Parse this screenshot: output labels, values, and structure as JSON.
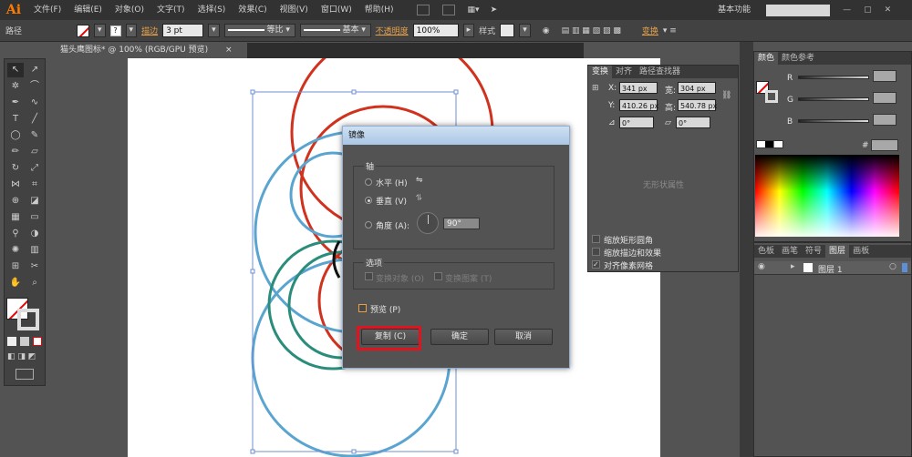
{
  "app_logo": "Ai",
  "menu": [
    "文件(F)",
    "编辑(E)",
    "对象(O)",
    "文字(T)",
    "选择(S)",
    "效果(C)",
    "视图(V)",
    "窗口(W)",
    "帮助(H)"
  ],
  "workspace": "基本功能",
  "control": {
    "path_label": "路径",
    "stroke_label": "描边",
    "stroke_value": "3 pt",
    "profile1": "等比",
    "profile2": "基本",
    "opacity_label": "不透明度",
    "opacity_value": "100%",
    "style_label": "样式",
    "transform_label": "变换"
  },
  "doc_tab": "猫头鹰图标* @ 100% (RGB/GPU 预览)",
  "dialog": {
    "title": "镜像",
    "axis_group": "轴",
    "horizontal": "水平 (H)",
    "vertical": "垂直 (V)",
    "angle_label": "角度 (A):",
    "angle_value": "90°",
    "options_group": "选项",
    "transform_objects": "变换对象 (O)",
    "transform_patterns": "变换图案 (T)",
    "preview": "预览 (P)",
    "copy_button": "复制 (C)",
    "ok_button": "确定",
    "cancel_button": "取消"
  },
  "transform_panel": {
    "tabs": [
      "变换",
      "对齐",
      "路径查找器"
    ],
    "x_label": "X:",
    "x_value": "341 px",
    "w_label": "宽:",
    "w_value": "304 px",
    "y_label": "Y:",
    "y_value": "410.26 px",
    "h_label": "高:",
    "h_value": "540.78 px",
    "angle1": "0°",
    "angle2": "0°",
    "no_shape": "无形状属性",
    "opt1": "缩放矩形圆角",
    "opt2": "缩放描边和效果",
    "opt3": "对齐像素网格"
  },
  "color_panel": {
    "tabs": [
      "颜色",
      "颜色参考"
    ],
    "r": "R",
    "g": "G",
    "b": "B",
    "hash": "#"
  },
  "layers_panel": {
    "tabs": [
      "色板",
      "画笔",
      "符号",
      "图层",
      "画板"
    ],
    "layer_name": "图层 1"
  },
  "colors": {
    "red": "#d0321e",
    "blue": "#5aa5cf",
    "teal": "#2a8c7a"
  }
}
